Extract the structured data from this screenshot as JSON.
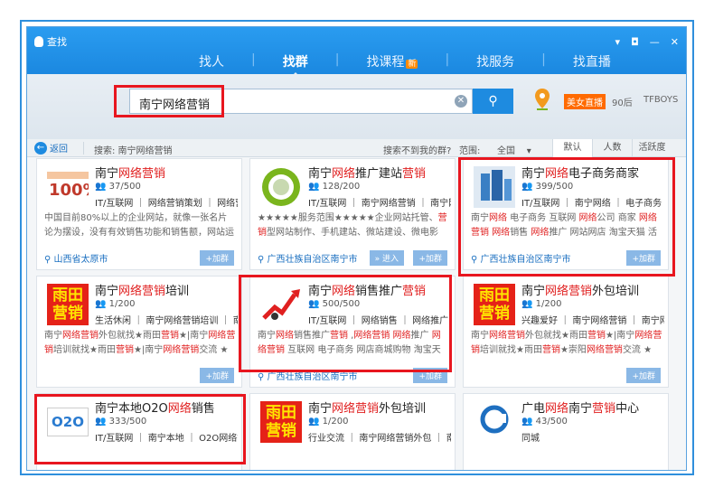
{
  "window": {
    "title": "查找"
  },
  "tabs": [
    {
      "label": "找人"
    },
    {
      "label": "找群"
    },
    {
      "label": "找课程",
      "badge": "新"
    },
    {
      "label": "找服务"
    },
    {
      "label": "找直播"
    }
  ],
  "search": {
    "value": "南宁网络营销"
  },
  "tags": {
    "live": "美女直播",
    "t1": "90后",
    "t2": "TFBOYS"
  },
  "toolbar": {
    "back": "返回",
    "search_label": "搜索: 南宁网络营销",
    "nofind": "搜索不到我的群?",
    "range_label": "范围:",
    "range_value": "全国",
    "sort": [
      "默认",
      "人数",
      "活跃度"
    ]
  },
  "cards": [
    {
      "name": "南宁网络营销",
      "count": "37/500",
      "cats": "IT/互联网 ｜ 网络营销策划 ｜ 网络营...",
      "desc": "中国目前80%以上的企业网站，就像一张名片论为摆设，没有有效销售功能和销售额，网站运营现...",
      "loc": "山西省太原市",
      "join": "+加群"
    },
    {
      "name": "南宁网络推广建站营销",
      "count": "128/200",
      "cats": "IT/互联网 ｜ 南宁网络营销 ｜ 南宁网...",
      "desc": "★★★★★服务范围★★★★★企业网站托管、营销型网站制作、手机建站、微站建设、微电影广...",
      "loc": "广西壮族自治区南宁市",
      "enter": "» 进入",
      "join": "+加群"
    },
    {
      "name": "南宁网络电子商务商家",
      "count": "399/500",
      "cats": "IT/互联网 ｜ 南宁网络 ｜ 电子商务 ｜ ...",
      "desc": "南宁网络 电子商务 互联网 网络公司 商家 网络营销 网络销售 网络推广 网站网店 淘宝天猫 活动...",
      "loc": "广西壮族自治区南宁市",
      "join": "+加群"
    },
    {
      "name": "南宁网络营销培训",
      "count": "1/200",
      "cats": "生活休闲 ｜ 南宁网络营销培训 ｜ 南...",
      "desc": "南宁网络营销外包就找★雨田营销★|南宁网络营销培训就找★雨田营销★|南宁网络营销交流 ★加...",
      "loc": "",
      "join": "+加群"
    },
    {
      "name": "南宁网络销售推广营销",
      "count": "500/500",
      "cats": "IT/互联网 ｜ 网络销售 ｜ 网络推广 ｜ ...",
      "desc": "南宁网络销售推广营销 ,网络营销 网络推广 网络营销 互联网 电子商务 网店商城购物 淘宝天猫 ...",
      "loc": "广西壮族自治区南宁市",
      "join": "+加群"
    },
    {
      "name": "南宁网络营销外包培训",
      "count": "1/200",
      "cats": "兴趣爱好 ｜ 南宁网络营销 ｜ 南宁网...",
      "desc": "南宁网络营销外包就找★雨田营销★|南宁网络营销培训就找★雨田营销★崇阳网络营销交流 ★加...",
      "loc": "",
      "join": "+加群"
    },
    {
      "name": "南宁本地O2O网络销售",
      "count": "333/500",
      "cats": "IT/互联网 ｜ 南宁本地 ｜ O2O网络销...",
      "desc": "",
      "loc": "",
      "join": ""
    },
    {
      "name": "南宁网络营销外包培训",
      "count": "1/200",
      "cats": "行业交流 ｜ 南宁网络营销外包 ｜ 南...",
      "desc": "",
      "loc": "",
      "join": ""
    },
    {
      "name": "广电网络南宁营销中心",
      "count": "43/500",
      "cats": "同城",
      "desc": "",
      "loc": "",
      "join": ""
    }
  ],
  "logo_texts": {
    "yutian": "雨田营销",
    "o2o": "O2O"
  }
}
